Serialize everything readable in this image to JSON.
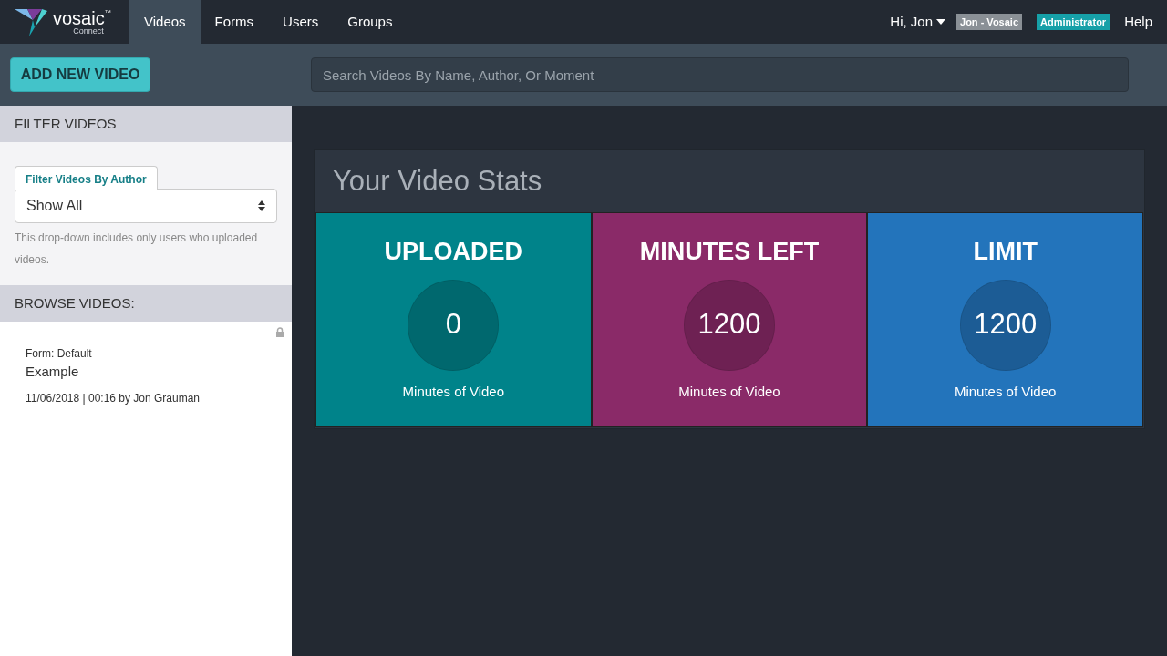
{
  "logo": {
    "name": "vosaic",
    "trademark": "™",
    "subtitle": "Connect"
  },
  "nav": [
    {
      "label": "Videos",
      "selected": true
    },
    {
      "label": "Forms",
      "selected": false
    },
    {
      "label": "Users",
      "selected": false
    },
    {
      "label": "Groups",
      "selected": false
    }
  ],
  "user": {
    "greeting": "Hi, Jon",
    "account_badge": "Jon - Vosaic",
    "role_badge": "Administrator",
    "help": "Help"
  },
  "toolbar": {
    "add_button": "ADD NEW VIDEO",
    "search": {
      "placeholder": "Search Videos By Name, Author, Or Moment"
    }
  },
  "sidebar": {
    "filter_heading": "FILTER VIDEOS",
    "filter_label": "Filter Videos By Author",
    "filter_value": "Show All",
    "filter_hint": "This drop-down includes only users who uploaded videos.",
    "browse_heading": "BROWSE VIDEOS:",
    "videos": [
      {
        "form": "Form: Default",
        "title": "Example",
        "meta": "11/06/2018 | 00:16 by Jon Grauman",
        "locked": true
      }
    ]
  },
  "stats": {
    "title": "Your Video Stats",
    "cards": [
      {
        "label": "UPLOADED",
        "value": "0",
        "caption": "Minutes of Video",
        "color": "#00838a"
      },
      {
        "label": "MINUTES LEFT",
        "value": "1200",
        "caption": "Minutes of Video",
        "color": "#8a2a68"
      },
      {
        "label": "LIMIT",
        "value": "1200",
        "caption": "Minutes of Video",
        "color": "#2374bb"
      }
    ]
  }
}
